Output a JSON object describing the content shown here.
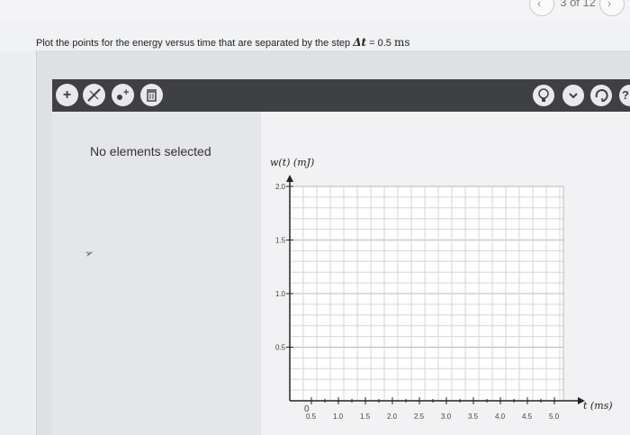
{
  "header": {
    "pager_text": "3 of 12",
    "prev_icon": "chevron-left-icon",
    "next_icon": "chevron-right-icon"
  },
  "question": {
    "prefix": "Plot the points for the energy versus time that are separated by the step ",
    "math_symbol": "Δt",
    "equals": " = 0.5 ",
    "unit": "ms"
  },
  "toolbar": {
    "add_label": "+",
    "line_icon": "line-tool-icon",
    "point_label": "+",
    "trash_icon": "trash-icon",
    "hint_icon": "lightbulb-icon",
    "dropdown_icon": "chevron-down-icon",
    "reset_icon": "reset-icon",
    "help_label": "?"
  },
  "sidebar": {
    "empty_text": "No elements selected"
  },
  "colors": {
    "toolbar_bg": "#3e4044",
    "grid_line": "#c9c9cc",
    "axis": "#222222"
  },
  "chart_data": {
    "type": "scatter",
    "title": "",
    "xlabel": "t (ms)",
    "ylabel": "w(t) (mJ)",
    "xlim": [
      0.5,
      5.0
    ],
    "ylim": [
      0,
      2.0
    ],
    "x_ticks": [
      "0.5",
      "1.0",
      "1.5",
      "2.0",
      "2.5",
      "3.0",
      "3.5",
      "4.0",
      "4.5",
      "5.0"
    ],
    "y_ticks": [
      "0.5",
      "1.0",
      "1.5",
      "2.0"
    ],
    "origin_label": "0",
    "grid": true,
    "series": [
      {
        "values": []
      }
    ]
  }
}
